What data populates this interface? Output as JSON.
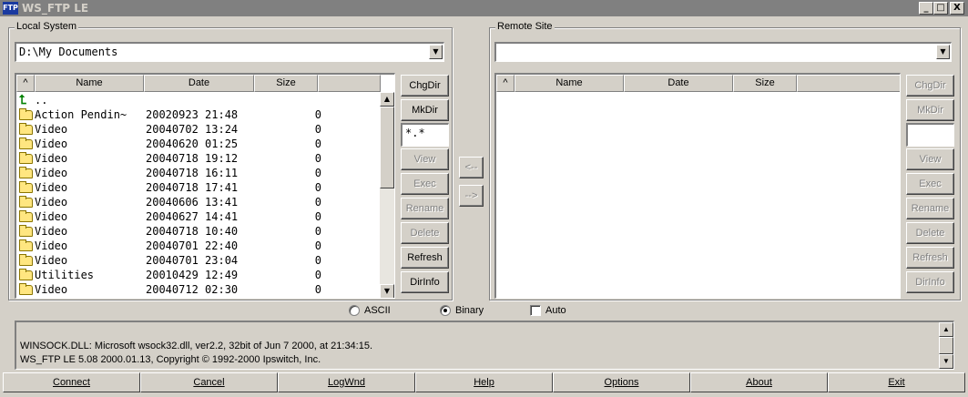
{
  "window": {
    "title": "WS_FTP LE",
    "icon_label": "FTP",
    "minimize": "_",
    "maximize": "□",
    "close": "X"
  },
  "local": {
    "group_label": "Local System",
    "path": "D:\\My Documents",
    "columns": [
      "^",
      "Name",
      "Date",
      "Size"
    ],
    "parent_entry": "..",
    "files": [
      {
        "name": "Action Pendin~",
        "date": "20020923 21:48",
        "size": "0"
      },
      {
        "name": "Video",
        "date": "20040702 13:24",
        "size": "0"
      },
      {
        "name": "Video",
        "date": "20040620 01:25",
        "size": "0"
      },
      {
        "name": "Video",
        "date": "20040718 19:12",
        "size": "0"
      },
      {
        "name": "Video",
        "date": "20040718 16:11",
        "size": "0"
      },
      {
        "name": "Video",
        "date": "20040718 17:41",
        "size": "0"
      },
      {
        "name": "Video",
        "date": "20040606 13:41",
        "size": "0"
      },
      {
        "name": "Video",
        "date": "20040627 14:41",
        "size": "0"
      },
      {
        "name": "Video",
        "date": "20040718 10:40",
        "size": "0"
      },
      {
        "name": "Video",
        "date": "20040701 22:40",
        "size": "0"
      },
      {
        "name": "Video",
        "date": "20040701 23:04",
        "size": "0"
      },
      {
        "name": "Utilities",
        "date": "20010429 12:49",
        "size": "0"
      },
      {
        "name": "Video",
        "date": "20040712 02:30",
        "size": "0"
      }
    ],
    "buttons": {
      "chgdir": "ChgDir",
      "mkdir": "MkDir",
      "mask": "*.*",
      "view": "View",
      "exec": "Exec",
      "rename": "Rename",
      "delete": "Delete",
      "refresh": "Refresh",
      "dirinfo": "DirInfo"
    }
  },
  "transfer": {
    "to_local": "<--",
    "to_remote": "-->"
  },
  "remote": {
    "group_label": "Remote Site",
    "path": "",
    "columns": [
      "^",
      "Name",
      "Date",
      "Size"
    ],
    "buttons": {
      "chgdir": "ChgDir",
      "mkdir": "MkDir",
      "mask": "",
      "view": "View",
      "exec": "Exec",
      "rename": "Rename",
      "delete": "Delete",
      "refresh": "Refresh",
      "dirinfo": "DirInfo"
    }
  },
  "mode": {
    "ascii": "ASCII",
    "binary": "Binary",
    "auto": "Auto",
    "selected": "Binary",
    "auto_checked": false
  },
  "log": {
    "lines": [
      "WINSOCK.DLL: Microsoft wsock32.dll, ver2.2, 32bit of Jun  7 2000, at 21:34:15.",
      "WS_FTP LE 5.08 2000.01.13, Copyright © 1992-2000 Ipswitch, Inc."
    ]
  },
  "bottom_buttons": {
    "connect": "Connect",
    "cancel": "Cancel",
    "logwnd": "LogWnd",
    "help": "Help",
    "options": "Options",
    "about": "About",
    "exit": "Exit"
  }
}
